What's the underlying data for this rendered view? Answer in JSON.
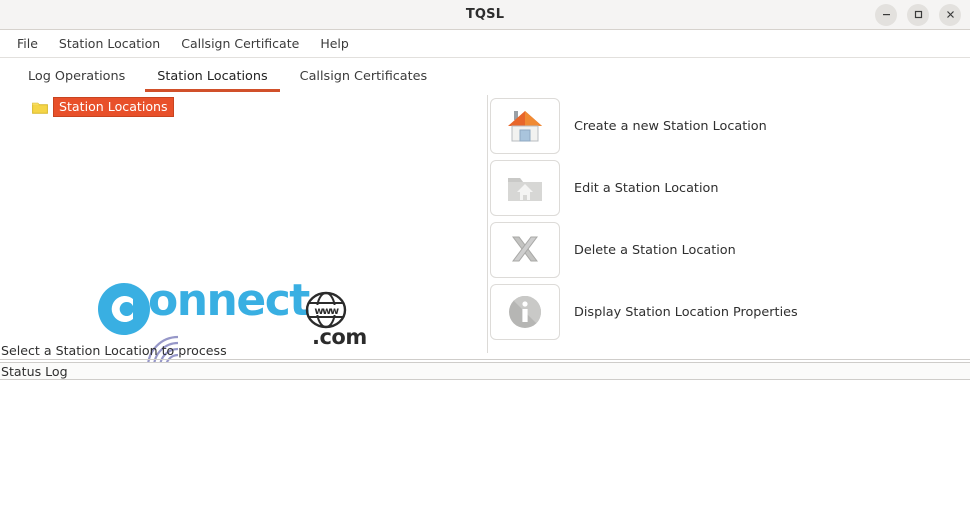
{
  "window": {
    "title": "TQSL",
    "controls": [
      {
        "name": "minimize",
        "glyph": "minimize-icon"
      },
      {
        "name": "maximize",
        "glyph": "maximize-icon"
      },
      {
        "name": "close",
        "glyph": "close-icon"
      }
    ]
  },
  "menubar": {
    "items": [
      {
        "label": "File"
      },
      {
        "label": "Station Location"
      },
      {
        "label": "Callsign Certificate"
      },
      {
        "label": "Help"
      }
    ]
  },
  "tabs": {
    "active_index": 1,
    "items": [
      {
        "label": "Log Operations"
      },
      {
        "label": "Station Locations"
      },
      {
        "label": "Callsign Certificates"
      }
    ],
    "active_underline_color": "#d1502a"
  },
  "tree": {
    "items": [
      {
        "label": "Station Locations",
        "icon": "folder-icon",
        "selected": true
      }
    ],
    "selection_bg": "#e8502a",
    "selection_fg": "#ffffff"
  },
  "watermark": {
    "text": "onnect",
    "leading_letter": "C",
    "suffix": ".com",
    "globe_text": "www",
    "color": "#29a9e0"
  },
  "actions": {
    "items": [
      {
        "label": "Create a new Station Location",
        "icon": "house-icon",
        "enabled": true
      },
      {
        "label": "Edit a Station Location",
        "icon": "folder-house-icon",
        "enabled": false
      },
      {
        "label": "Delete a Station Location",
        "icon": "x-cross-icon",
        "enabled": false
      },
      {
        "label": "Display Station Location Properties",
        "icon": "info-icon",
        "enabled": false
      }
    ]
  },
  "hint": {
    "text": "Select a Station Location to process"
  },
  "status_log": {
    "title": "Status Log",
    "entries": []
  }
}
